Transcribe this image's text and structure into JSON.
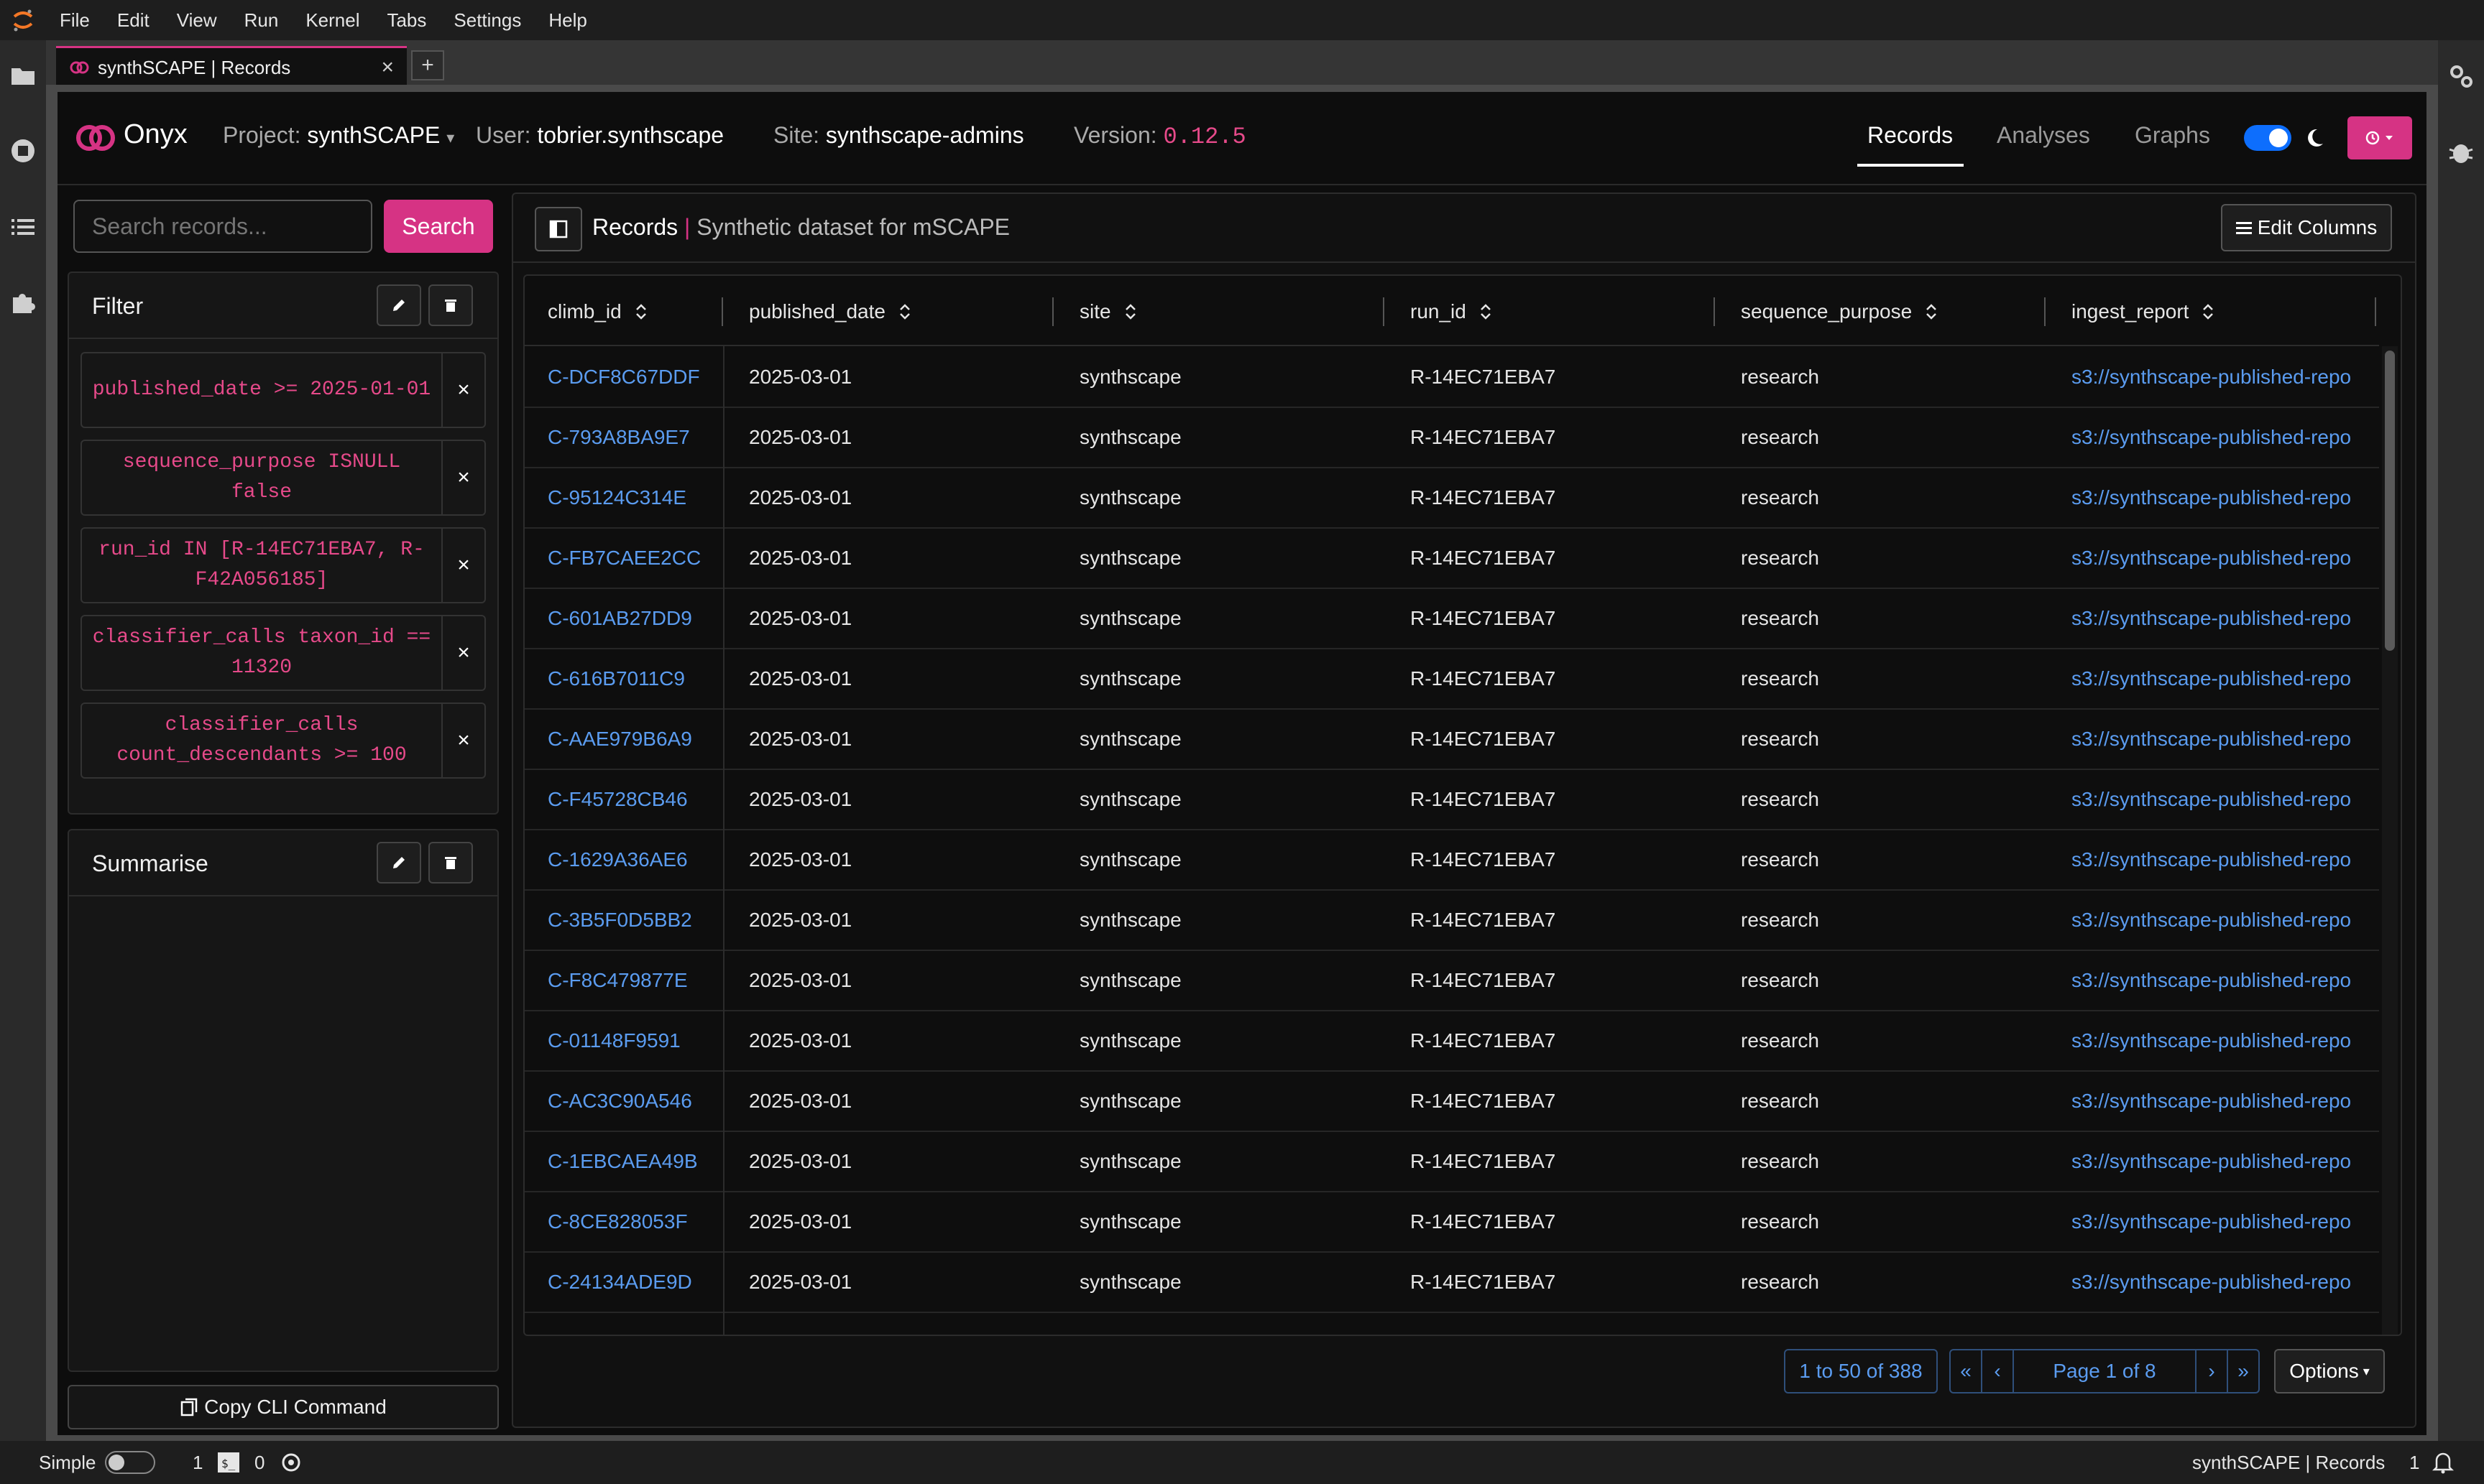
{
  "menubar": {
    "items": [
      "File",
      "Edit",
      "View",
      "Run",
      "Kernel",
      "Tabs",
      "Settings",
      "Help"
    ]
  },
  "tab": {
    "title": "synthSCAPE | Records",
    "close": "×",
    "add": "+"
  },
  "header": {
    "app_name": "Onyx",
    "project_label": "Project:",
    "project_value": "synthSCAPE",
    "user_label": "User:",
    "user_value": "tobrier.synthscape",
    "site_label": "Site:",
    "site_value": "synthscape-admins",
    "version_label": "Version:",
    "version_value": "0.12.5",
    "nav": [
      "Records",
      "Analyses",
      "Graphs"
    ],
    "active_nav": "Records",
    "accent_color": "#d63384"
  },
  "search": {
    "placeholder": "Search records...",
    "button": "Search"
  },
  "filter": {
    "title": "Filter",
    "chips": [
      "published_date >= 2025-01-01",
      "sequence_purpose ISNULL false",
      "run_id IN [R-14EC71EBA7, R-F42A056185]",
      "classifier_calls taxon_id == 11320",
      "classifier_calls count_descendants >= 100"
    ],
    "chip_remove": "×"
  },
  "summarise": {
    "title": "Summarise"
  },
  "copy_cli": "Copy CLI Command",
  "records": {
    "title": "Records",
    "separator": "|",
    "subtitle": "Synthetic dataset for mSCAPE",
    "edit_columns": "Edit Columns",
    "columns": [
      "climb_id",
      "published_date",
      "site",
      "run_id",
      "sequence_purpose",
      "ingest_report"
    ],
    "rows": [
      [
        "C-DCF8C67DDF",
        "2025-03-01",
        "synthscape",
        "R-14EC71EBA7",
        "research",
        "s3://synthscape-published-repo"
      ],
      [
        "C-793A8BA9E7",
        "2025-03-01",
        "synthscape",
        "R-14EC71EBA7",
        "research",
        "s3://synthscape-published-repo"
      ],
      [
        "C-95124C314E",
        "2025-03-01",
        "synthscape",
        "R-14EC71EBA7",
        "research",
        "s3://synthscape-published-repo"
      ],
      [
        "C-FB7CAEE2CC",
        "2025-03-01",
        "synthscape",
        "R-14EC71EBA7",
        "research",
        "s3://synthscape-published-repo"
      ],
      [
        "C-601AB27DD9",
        "2025-03-01",
        "synthscape",
        "R-14EC71EBA7",
        "research",
        "s3://synthscape-published-repo"
      ],
      [
        "C-616B7011C9",
        "2025-03-01",
        "synthscape",
        "R-14EC71EBA7",
        "research",
        "s3://synthscape-published-repo"
      ],
      [
        "C-AAE979B6A9",
        "2025-03-01",
        "synthscape",
        "R-14EC71EBA7",
        "research",
        "s3://synthscape-published-repo"
      ],
      [
        "C-F45728CB46",
        "2025-03-01",
        "synthscape",
        "R-14EC71EBA7",
        "research",
        "s3://synthscape-published-repo"
      ],
      [
        "C-1629A36AE6",
        "2025-03-01",
        "synthscape",
        "R-14EC71EBA7",
        "research",
        "s3://synthscape-published-repo"
      ],
      [
        "C-3B5F0D5BB2",
        "2025-03-01",
        "synthscape",
        "R-14EC71EBA7",
        "research",
        "s3://synthscape-published-repo"
      ],
      [
        "C-F8C479877E",
        "2025-03-01",
        "synthscape",
        "R-14EC71EBA7",
        "research",
        "s3://synthscape-published-repo"
      ],
      [
        "C-01148F9591",
        "2025-03-01",
        "synthscape",
        "R-14EC71EBA7",
        "research",
        "s3://synthscape-published-repo"
      ],
      [
        "C-AC3C90A546",
        "2025-03-01",
        "synthscape",
        "R-14EC71EBA7",
        "research",
        "s3://synthscape-published-repo"
      ],
      [
        "C-1EBCAEA49B",
        "2025-03-01",
        "synthscape",
        "R-14EC71EBA7",
        "research",
        "s3://synthscape-published-repo"
      ],
      [
        "C-8CE828053F",
        "2025-03-01",
        "synthscape",
        "R-14EC71EBA7",
        "research",
        "s3://synthscape-published-repo"
      ],
      [
        "C-24134ADE9D",
        "2025-03-01",
        "synthscape",
        "R-14EC71EBA7",
        "research",
        "s3://synthscape-published-repo"
      ]
    ]
  },
  "pagination": {
    "count": "1 to 50 of 388",
    "first": "«",
    "prev": "‹",
    "page": "Page 1 of 8",
    "next": "›",
    "last": "»",
    "options": "Options"
  },
  "statusbar": {
    "mode": "Simple",
    "terminals": "1",
    "kernels": "0",
    "doc_title": "synthSCAPE | Records",
    "notifications": "1"
  }
}
